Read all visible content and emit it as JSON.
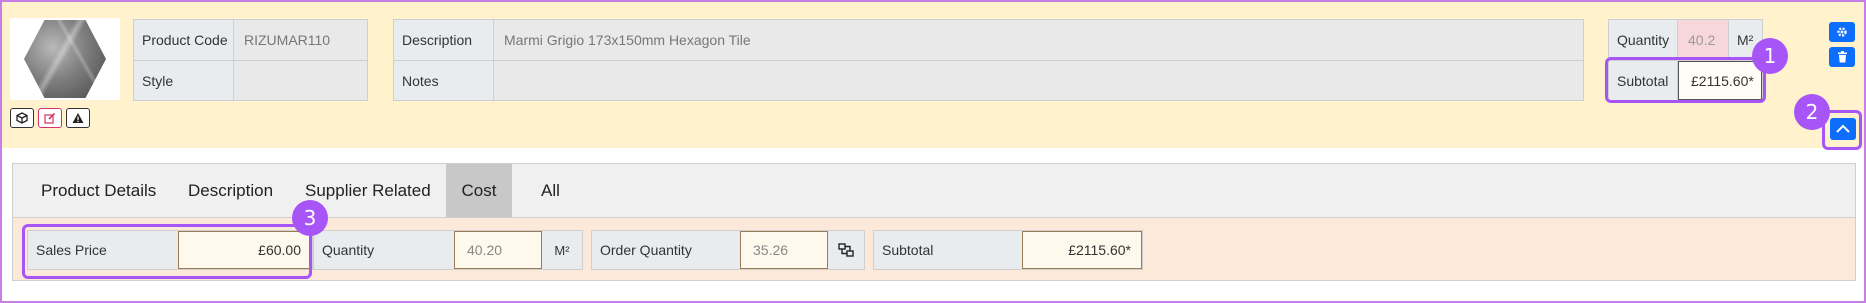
{
  "product": {
    "code_label": "Product Code",
    "code_value": "RIZUMAR110",
    "style_label": "Style",
    "style_value": "",
    "description_label": "Description",
    "description_value": "Marmi  Grigio 173x150mm Hexagon Tile",
    "notes_label": "Notes",
    "notes_value": "",
    "quantity_label": "Quantity",
    "quantity_value": "40.2",
    "quantity_unit": "M²",
    "subtotal_label": "Subtotal",
    "subtotal_value": "£2115.60*"
  },
  "image_actions": [
    {
      "icon": "cube-icon"
    },
    {
      "icon": "edit-icon"
    },
    {
      "icon": "warning-icon"
    }
  ],
  "row_actions": [
    {
      "icon": "gear-icon"
    },
    {
      "icon": "trash-icon"
    }
  ],
  "collapse": {
    "icon": "chevron-up-icon"
  },
  "badges": [
    "1",
    "2",
    "3"
  ],
  "tabs": [
    {
      "label": "Product Details",
      "active": false
    },
    {
      "label": "Description",
      "active": false
    },
    {
      "label": "Supplier Related",
      "active": false
    },
    {
      "label": "Cost",
      "active": true
    },
    {
      "label": "All",
      "active": false
    }
  ],
  "cost": {
    "sales_price_label": "Sales Price",
    "sales_price_value": "£60.00",
    "quantity_label": "Quantity",
    "quantity_value": "40.20",
    "quantity_unit": "M²",
    "order_quantity_label": "Order Quantity",
    "order_quantity_value": "35.26",
    "subtotal_label": "Subtotal",
    "subtotal_value": "£2115.60*"
  },
  "colors": {
    "accent": "#0d6efd",
    "highlight": "#a855f7",
    "top_band": "#fff2cc",
    "cost_band": "#fde9d9",
    "quantity_bg": "#f8d7da"
  }
}
